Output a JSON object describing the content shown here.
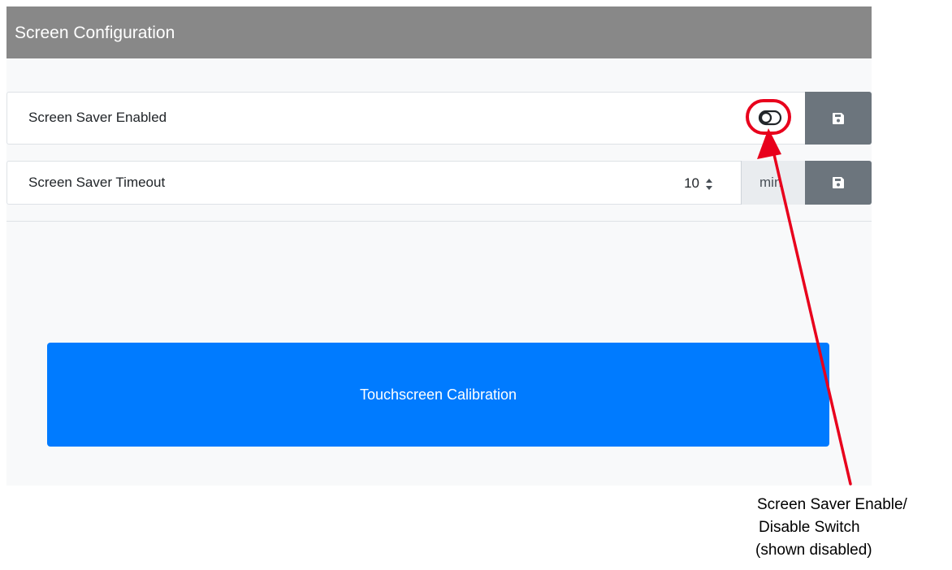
{
  "panel": {
    "title": "Screen Configuration"
  },
  "screen_saver_enabled": {
    "label": "Screen Saver Enabled",
    "toggle_state": "off",
    "save_icon": "floppy-disk-icon"
  },
  "screen_saver_timeout": {
    "label": "Screen Saver Timeout",
    "value": "10",
    "unit": "min",
    "save_icon": "floppy-disk-icon"
  },
  "calibration": {
    "button_label": "Touchscreen Calibration"
  },
  "annotation": {
    "line1": "Screen Saver Enable/",
    "line2": "Disable Switch",
    "line3": "(shown disabled)"
  },
  "colors": {
    "header": "#888888",
    "save_button": "#6c757d",
    "primary_button": "#007bff",
    "callout": "#e8001c"
  }
}
